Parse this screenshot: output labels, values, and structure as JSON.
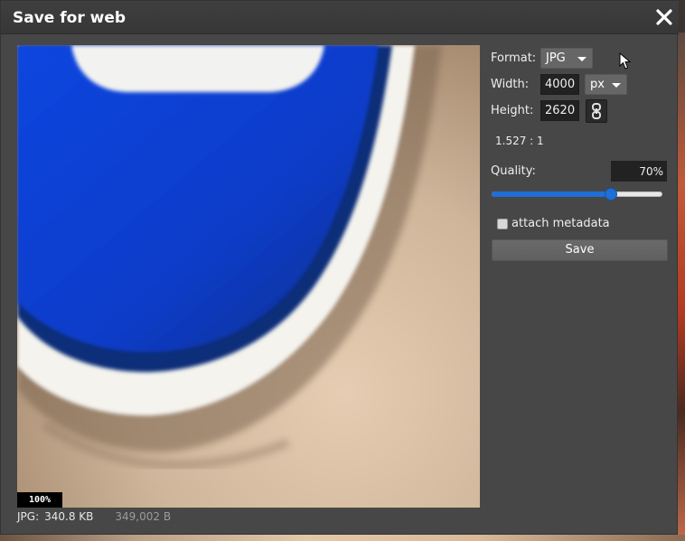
{
  "dialog": {
    "title": "Save for web",
    "close_icon": "close-icon"
  },
  "preview": {
    "zoom": "100%"
  },
  "footer": {
    "format": "JPG:",
    "size_kb": "340.8 KB",
    "size_bytes": "349,002 B"
  },
  "settings": {
    "format_label": "Format:",
    "format_value": "JPG",
    "width_label": "Width:",
    "width_value": "4000",
    "unit_value": "px",
    "height_label": "Height:",
    "height_value": "2620",
    "link_icon": "chain-link-icon",
    "ratio": "1.527 : 1",
    "quality_label": "Quality:",
    "quality_value": "70%",
    "quality_fraction": 0.7,
    "metadata_label": "attach metadata",
    "metadata_checked": false,
    "save_label": "Save"
  },
  "colors": {
    "accent": "#1f6fd6",
    "dialog_bg": "#474747",
    "input_bg": "#222222"
  }
}
